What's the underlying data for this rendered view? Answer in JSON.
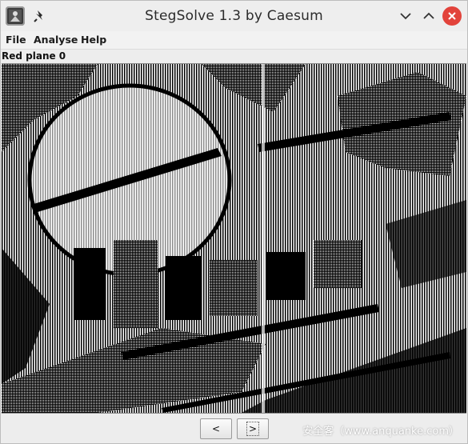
{
  "window": {
    "title": "StegSolve 1.3 by Caesum",
    "icons": {
      "app": "stegsolve-app-icon",
      "pin": "pin-icon",
      "minimize": "chevron-down-icon",
      "maximize": "chevron-up-icon",
      "close": "close-icon"
    }
  },
  "menu": {
    "items": [
      "File",
      "Analyse",
      "Help"
    ]
  },
  "viewer": {
    "plane_label": "Red plane 0"
  },
  "nav": {
    "prev_label": "<",
    "next_label": ">"
  },
  "watermark": {
    "text": "安全客（www.anquanke.com）"
  },
  "colors": {
    "close_button": "#e2433b",
    "titlebar": "#eeeeee",
    "image_dark": "#000000",
    "image_light": "#ffffff"
  }
}
